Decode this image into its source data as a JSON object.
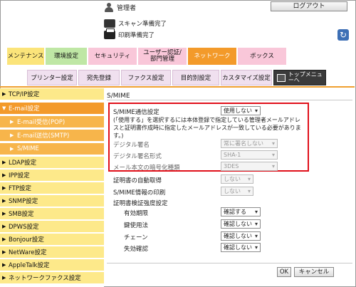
{
  "header": {
    "user": "管理者",
    "logout_label": "ログアウト",
    "scan_status": "スキャン準備完了",
    "print_status": "印刷準備完了"
  },
  "main_tabs": [
    {
      "label": "メンテナンス",
      "color": "#fbe47a",
      "w": 52
    },
    {
      "label": "環境設定",
      "color": "#bfe7a5",
      "w": 58
    },
    {
      "label": "セキュリティ",
      "color": "#f9c7d9",
      "w": 68
    },
    {
      "label": "ユーザー認証/部門管理",
      "color": "#f9c7d9",
      "w": 68
    },
    {
      "label": "ネットワーク",
      "color": "#f39a2a",
      "w": 68
    },
    {
      "label": "ボックス",
      "color": "#f9c7d9",
      "w": 68
    }
  ],
  "sub_tabs": [
    {
      "label": "プリンター設定",
      "w": 70
    },
    {
      "label": "宛先登録",
      "w": 58
    },
    {
      "label": "ファクス設定",
      "w": 70
    },
    {
      "label": "目的別設定",
      "w": 66
    },
    {
      "label": "カスタマイズ設定",
      "w": 72
    }
  ],
  "top_menu_label": "トップメニューへ",
  "sidebar": [
    {
      "label": "TCP/IP設定",
      "kind": "normal"
    },
    {
      "label": "E-mail設定",
      "kind": "open"
    },
    {
      "label": "E-mail受信(POP)",
      "kind": "sub"
    },
    {
      "label": "E-mail送信(SMTP)",
      "kind": "sub"
    },
    {
      "label": "S/MIME",
      "kind": "active"
    },
    {
      "label": "LDAP設定",
      "kind": "normal"
    },
    {
      "label": "IPP設定",
      "kind": "normal"
    },
    {
      "label": "FTP設定",
      "kind": "normal"
    },
    {
      "label": "SNMP設定",
      "kind": "normal"
    },
    {
      "label": "SMB設定",
      "kind": "normal"
    },
    {
      "label": "DPWS設定",
      "kind": "normal"
    },
    {
      "label": "Bonjour設定",
      "kind": "normal"
    },
    {
      "label": "NetWare設定",
      "kind": "normal"
    },
    {
      "label": "AppleTalk設定",
      "kind": "normal"
    },
    {
      "label": "ネットワークファクス設定",
      "kind": "normal"
    }
  ],
  "content": {
    "title": "S/MIME",
    "smime_comm_label": "S/MIME通信設定",
    "smime_comm_value": "使用しない",
    "note": "(「使用する」を選択するには本体登録で指定している管理者メールアドレスと証明書作成時に指定したメールアドレスが一致している必要があります。)",
    "digital_sign_label": "デジタル署名",
    "digital_sign_value": "常に署名しない",
    "sign_format_label": "デジタル署名形式",
    "sign_format_value": "SHA-1",
    "encrypt_label": "メール本文の暗号化種類",
    "encrypt_value": "3DES",
    "auto_cert_label": "証明書の自動取得",
    "auto_cert_value": "しない",
    "smime_print_label": "S/MIME情報の印刷",
    "smime_print_value": "しない",
    "verify_label": "証明書検証強度設定",
    "validity_label": "有効期限",
    "validity_value": "確認する",
    "key_usage_label": "鍵使用法",
    "key_usage_value": "確認しない",
    "chain_label": "チェーン",
    "chain_value": "確認しない",
    "revoke_label": "失効確認",
    "revoke_value": "確認しない",
    "ok_label": "OK",
    "cancel_label": "キャンセル"
  }
}
